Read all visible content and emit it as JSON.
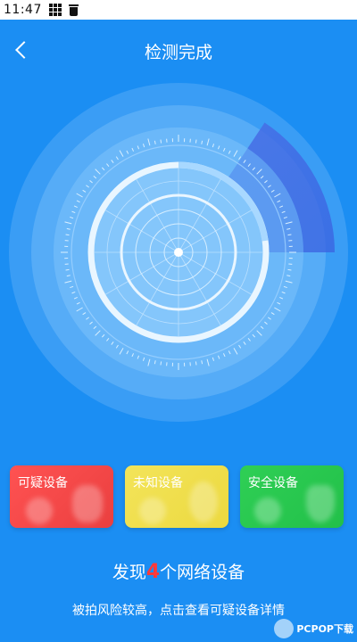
{
  "status_bar": {
    "time": "11:47",
    "icons": [
      "grid-icon",
      "trash-icon"
    ]
  },
  "header": {
    "title": "检测完成",
    "back_icon": "chevron-left-icon"
  },
  "cards": [
    {
      "label": "可疑设备",
      "color": "#f14848"
    },
    {
      "label": "未知设备",
      "color": "#efde4c"
    },
    {
      "label": "安全设备",
      "color": "#27c64f"
    }
  ],
  "result": {
    "prefix": "发现",
    "count": "4",
    "suffix": "个网络设备"
  },
  "hint": "被拍风险较高，点击查看可疑设备详情",
  "watermark": {
    "text": "PCPOP下载"
  },
  "colors": {
    "background": "#1b8ef3",
    "accent_red": "#ff3a3a"
  }
}
